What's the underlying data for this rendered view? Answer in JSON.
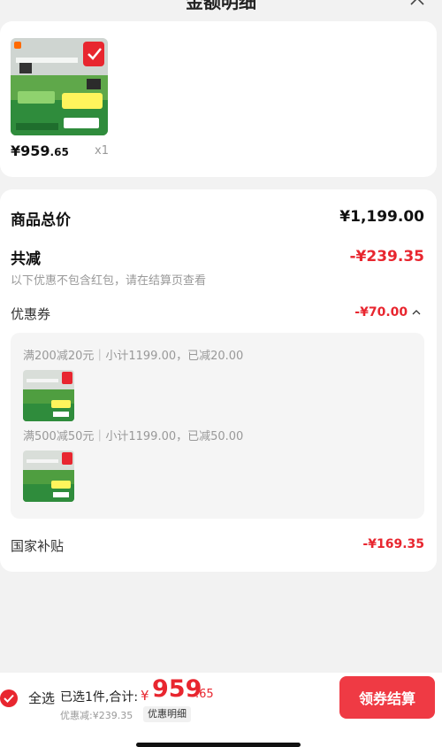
{
  "header": {
    "title": "金额明细"
  },
  "product": {
    "price_int": "¥959",
    "price_dec": ".65",
    "quantity": "x1"
  },
  "summary": {
    "total_label": "商品总价",
    "total_value": "¥1,199.00",
    "reduce_label": "共减",
    "reduce_value": "-¥239.35",
    "note": "以下优惠不包含红包，请在结算页查看",
    "coupon_label": "优惠券",
    "coupon_value": "-¥70.00",
    "coupons": [
      {
        "text": "满200减20元｜小计1199.00，已减20.00"
      },
      {
        "text": "满500减50元｜小计1199.00，已减50.00"
      }
    ],
    "subsidy_label": "国家补贴",
    "subsidy_value": "-¥169.35"
  },
  "bottom": {
    "select_all": "全选",
    "selected_text": "已选1件,合计:",
    "total_symbol": "¥",
    "total_int": "959",
    "total_dec": ".65",
    "discount_text": "优惠减:¥239.35",
    "detail_link": "优惠明细",
    "checkout": "领券结算"
  },
  "colors": {
    "accent": "#e8262f",
    "button": "#ef3a44"
  }
}
